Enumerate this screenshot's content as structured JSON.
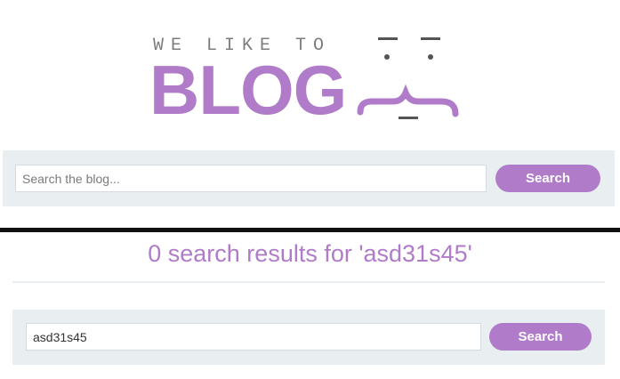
{
  "logo": {
    "tagline": "WE LIKE TO",
    "wordmark": "BLOG",
    "face_icon": "face-icon"
  },
  "top_search": {
    "placeholder": "Search the blog...",
    "value": "",
    "button_label": "Search"
  },
  "results": {
    "heading": "0 search results for 'asd31s45'"
  },
  "bottom_search": {
    "value": "asd31s45",
    "button_label": "Search"
  },
  "colors": {
    "accent": "#b07bc9",
    "bar_background": "#e9eef1",
    "tagline": "#7d7d7d"
  }
}
